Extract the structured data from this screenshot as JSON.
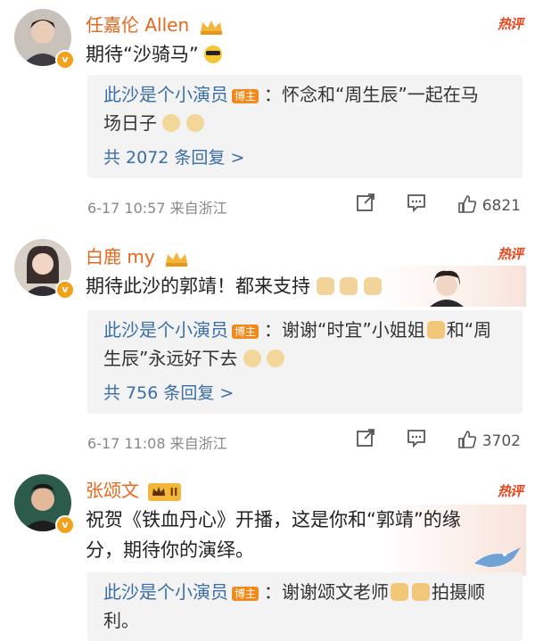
{
  "comments": [
    {
      "user": "任嘉伦 Allen",
      "hot_label": "热评",
      "text": "期待“沙骑马”",
      "reply_user": "此沙是个小演员",
      "reply_tag": "博主",
      "reply_text_1": "：怀念和“周生辰”一起在马",
      "reply_text_2": "场日子",
      "more": "共 2072 条回复 >",
      "meta": "6-17 10:57  来自浙江",
      "likes": "6821"
    },
    {
      "user": "白鹿 my",
      "hot_label": "热评",
      "text": "期待此沙的郭靖！都来支持",
      "reply_user": "此沙是个小演员",
      "reply_tag": "博主",
      "reply_text_1": "：谢谢“时宜”小姐姐",
      "reply_text_1b": "和“周",
      "reply_text_2": "生辰”永远好下去",
      "more": "共 756 条回复 >",
      "meta": "6-17 11:08  来自浙江",
      "likes": "3702"
    },
    {
      "user": "张颂文",
      "level": "II",
      "hot_label": "热评",
      "text_1": "祝贺《铁血丹心》开播，这是你和“郭靖”的缘",
      "text_2": "分，期待你的演绎。",
      "reply_user": "此沙是个小演员",
      "reply_tag": "博主",
      "reply_text_1": "：谢谢颂文老师",
      "reply_text_1b": "拍摄顺",
      "reply_text_2": "利。"
    }
  ],
  "colors": {
    "username": "#e8661a",
    "link": "#3a6ea8",
    "hot": "#e8451d",
    "badge": "#f3a01b"
  }
}
